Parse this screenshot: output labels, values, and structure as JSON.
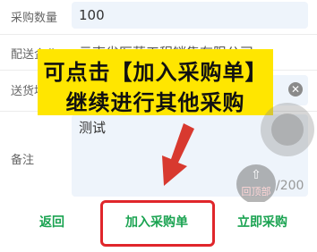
{
  "form": {
    "quantity_label": "采购数量",
    "quantity_value": "100",
    "delivery_company_label": "配送企业",
    "delivery_company_value": "云南省医药工程销售有限公司",
    "delivery_address_label": "送货地址",
    "note_label": "备注",
    "note_value": "测试",
    "note_counter": "/200",
    "clear_icon": "✕"
  },
  "overlay": {
    "banner_line1": "可点击【加入采购单】",
    "banner_line2": "继续进行其他采购",
    "banner_color": "#ffe600",
    "arrow_color": "#d8392f",
    "highlight_color": "#e0262b"
  },
  "floating": {
    "back_top_label": "回顶部",
    "back_top_icon": "⇧"
  },
  "bottom_bar": {
    "back_label": "返回",
    "add_to_order_label": "加入采购单",
    "buy_now_label": "立即采购",
    "accent_color": "#1aa351"
  }
}
